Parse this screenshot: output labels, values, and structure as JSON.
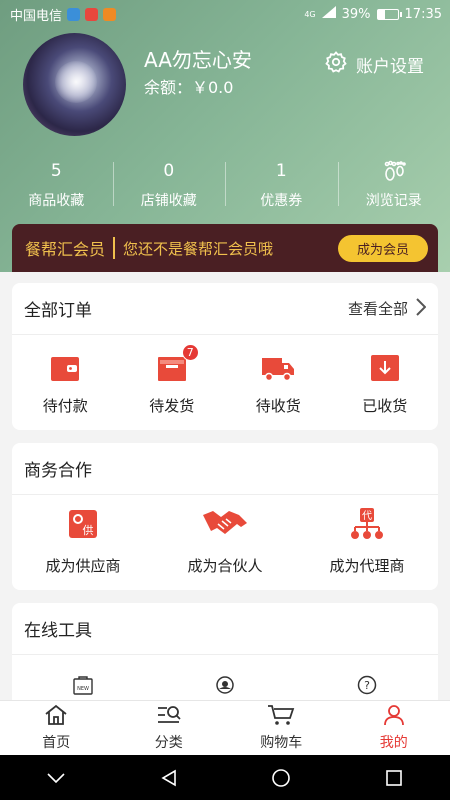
{
  "status": {
    "carrier": "中国电信",
    "network": "4G",
    "battery": "39%",
    "battery_level": 0.39,
    "time": "17:35"
  },
  "profile": {
    "username": "AA勿忘心安",
    "balance": "余额：￥0.0",
    "account_settings": "账户设置"
  },
  "stats": [
    {
      "num": "5",
      "label": "商品收藏"
    },
    {
      "num": "0",
      "label": "店铺收藏"
    },
    {
      "num": "1",
      "label": "优惠券"
    },
    {
      "label": "浏览记录",
      "icon": "footprint-icon"
    }
  ],
  "vip": {
    "title": "餐帮汇会员",
    "text": "您还不是餐帮汇会员哦",
    "button": "成为会员"
  },
  "orders": {
    "title": "全部订单",
    "see_all": "查看全部",
    "items": [
      {
        "label": "待付款",
        "icon": "wallet-icon"
      },
      {
        "label": "待发货",
        "icon": "package-icon",
        "badge": "7"
      },
      {
        "label": "待收货",
        "icon": "truck-icon"
      },
      {
        "label": "已收货",
        "icon": "received-icon"
      }
    ]
  },
  "business": {
    "title": "商务合作",
    "items": [
      {
        "label": "成为供应商",
        "icon": "supplier-icon",
        "glyph": "供"
      },
      {
        "label": "成为合伙人",
        "icon": "handshake-icon"
      },
      {
        "label": "成为代理商",
        "icon": "agent-icon",
        "glyph": "代"
      }
    ]
  },
  "tools": {
    "title": "在线工具",
    "items": [
      {
        "icon": "new-bag-icon",
        "glyph": "NEW"
      },
      {
        "icon": "service-icon"
      },
      {
        "icon": "help-icon",
        "glyph": "?"
      }
    ]
  },
  "tabbar": [
    {
      "label": "首页",
      "icon": "home-icon"
    },
    {
      "label": "分类",
      "icon": "category-icon"
    },
    {
      "label": "购物车",
      "icon": "cart-icon"
    },
    {
      "label": "我的",
      "icon": "profile-icon",
      "active": true
    }
  ],
  "colors": {
    "accent": "#e53935",
    "header_green": "#86b596",
    "vip_bg": "#4a1f23",
    "vip_gold": "#f0c04d"
  }
}
